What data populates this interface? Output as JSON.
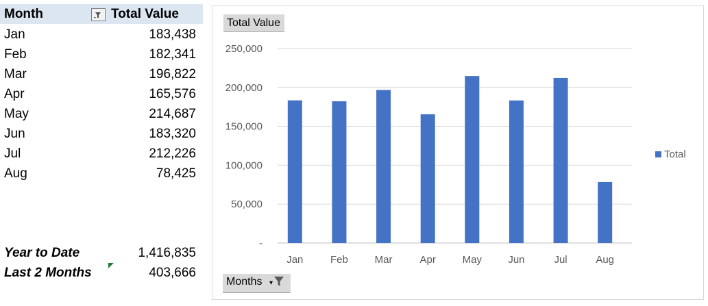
{
  "pivot": {
    "header_month": "Month",
    "header_total": "Total Value",
    "rows": [
      {
        "month": "Jan",
        "value": "183,438"
      },
      {
        "month": "Feb",
        "value": "182,341"
      },
      {
        "month": "Mar",
        "value": "196,822"
      },
      {
        "month": "Apr",
        "value": "165,576"
      },
      {
        "month": "May",
        "value": "214,687"
      },
      {
        "month": "Jun",
        "value": "183,320"
      },
      {
        "month": "Jul",
        "value": "212,226"
      },
      {
        "month": "Aug",
        "value": "78,425"
      }
    ],
    "ytd_label": "Year to Date",
    "ytd_value": "1,416,835",
    "last2_label": "Last 2 Months",
    "last2_value": "403,666"
  },
  "chart_buttons": {
    "title_button": "Total Value",
    "months_button": "Months"
  },
  "chart_data": {
    "type": "bar",
    "categories": [
      "Jan",
      "Feb",
      "Mar",
      "Apr",
      "May",
      "Jun",
      "Jul",
      "Aug"
    ],
    "series": [
      {
        "name": "Total",
        "values": [
          183438,
          182341,
          196822,
          165576,
          214687,
          183320,
          212226,
          78425
        ],
        "color": "#4472c4"
      }
    ],
    "ylim": [
      0,
      250000
    ],
    "yticks": [
      "-",
      "50,000",
      "100,000",
      "150,000",
      "200,000",
      "250,000"
    ],
    "grid": true,
    "legend_position": "right"
  }
}
